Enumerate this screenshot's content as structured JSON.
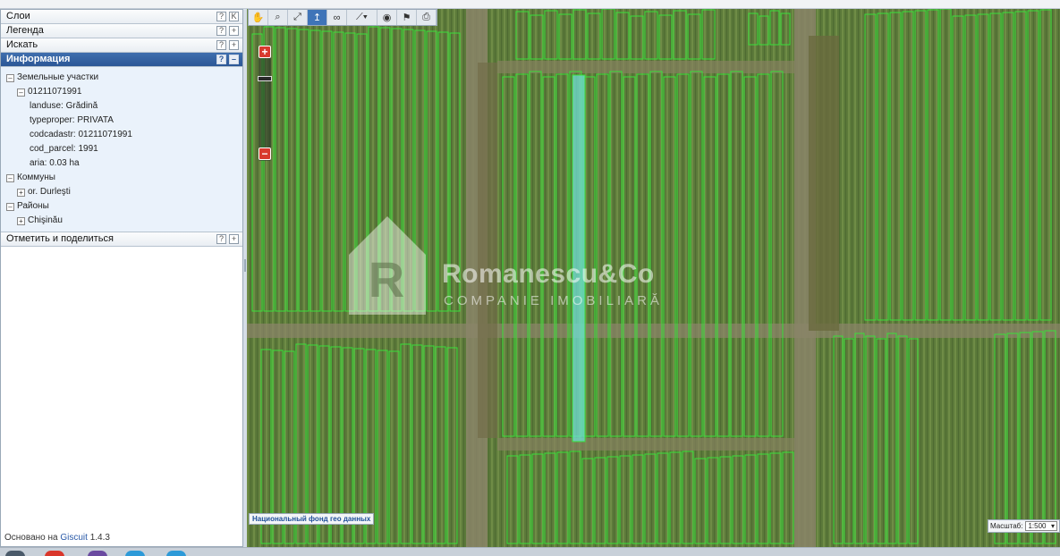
{
  "panel": {
    "sections": [
      {
        "label": "Слои",
        "btn1": "?",
        "btn2": "K"
      },
      {
        "label": "Легенда",
        "btn1": "?",
        "btn2": "+"
      },
      {
        "label": "Искать",
        "btn1": "?",
        "btn2": "+"
      },
      {
        "label": "Информация",
        "btn1": "?",
        "btn2": "–"
      }
    ],
    "share": {
      "label": "Отметить и поделиться",
      "btn1": "?",
      "btn2": "+"
    },
    "tree": {
      "group1": "Земельные участки",
      "parcel_id": "01211071991",
      "landuse": "landuse: Grădină",
      "typeproper": "typeproper: PRIVATA",
      "codcadastr": "codcadastr: 01211071991",
      "cod_parcel": "cod_parcel: 1991",
      "aria": "aria: 0.03 ha",
      "group2": "Коммуны",
      "commune": "or. Durleşti",
      "group3": "Районы",
      "district": "Chişinău",
      "collapse_glyph": "–",
      "expand_glyph": "+"
    },
    "footer": {
      "prefix": "Основано на",
      "link": "Giscuit",
      "version": "1.4.3"
    }
  },
  "toolbar": {
    "icons": [
      "hand-icon",
      "zoom-box-icon",
      "full-extent-icon",
      "identify-icon",
      "binoculars-icon",
      "measure-icon",
      "target-icon",
      "flag-icon",
      "print-icon"
    ],
    "glyphs": [
      "✋",
      "⌕",
      "⤢",
      "↥",
      "∞",
      "⟋▾",
      "◉",
      "⚑",
      "⎙"
    ],
    "active_index": 3
  },
  "zoom": {
    "plus": "+",
    "minus": "−",
    "level_fraction": 0.8
  },
  "attribution": "Национальный фонд гео данных",
  "scale": {
    "label": "Масштаб:",
    "value": "1:500",
    "arrow": "▾"
  },
  "watermark": {
    "name": "Romanescu&Co",
    "subtitle": "COMPANIE IMOBILIARĂ"
  },
  "colors": {
    "accent": "#2c5796",
    "parcel_outline": "#39e03a",
    "selected_parcel": "#6fe0d6",
    "zoom_button": "#d93a2e"
  }
}
